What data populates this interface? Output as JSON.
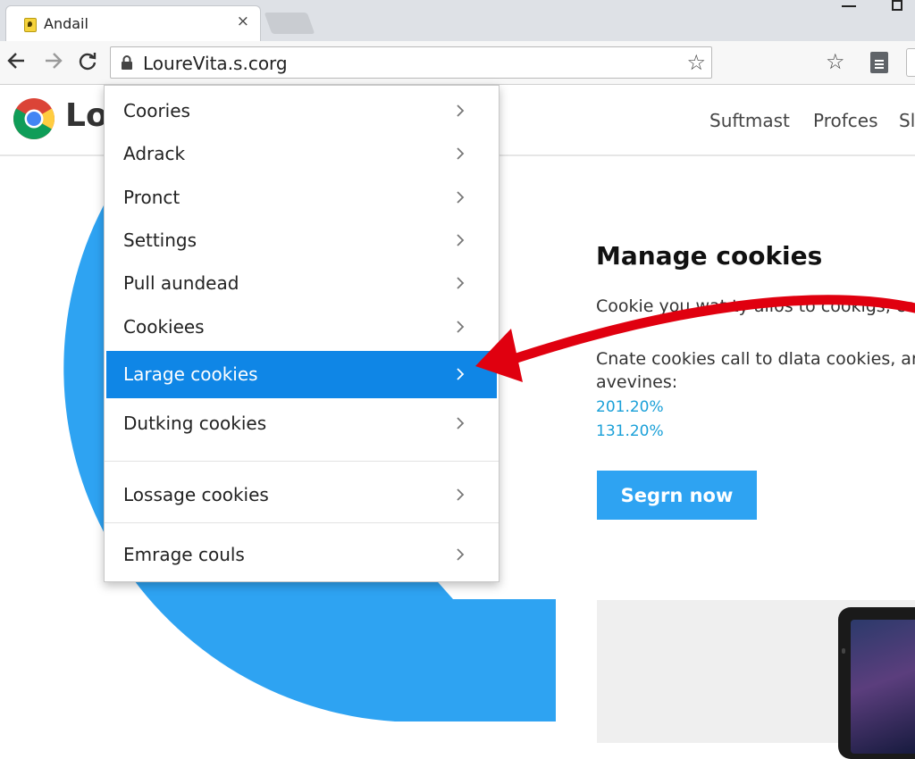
{
  "browser": {
    "tab_title": "Andail",
    "tab_close": "×",
    "url": "LoureVita.s.corg"
  },
  "site": {
    "name": "Lou",
    "nav": [
      "Suftmast",
      "Profces",
      "Sl"
    ]
  },
  "menu": {
    "items": [
      {
        "label": "Coories"
      },
      {
        "label": "Adrack"
      },
      {
        "label": "Pronct"
      },
      {
        "label": "Settings"
      },
      {
        "label": "Pull aundead"
      },
      {
        "label": "Cookiees"
      },
      {
        "label": "Larage cookies",
        "selected": true
      },
      {
        "label": "Dutking cookies"
      },
      {
        "label": "Lossage cookies"
      },
      {
        "label": "Emrage couls"
      }
    ]
  },
  "content": {
    "title": "Manage cookies",
    "line1": "Cookie you wat ty allos to cookigs, cool",
    "line2": "Cnate cookies call to dlata cookies, and",
    "line3": "avevines:",
    "stats": [
      "201.20%",
      "131.20%"
    ],
    "cta": "Segrn now"
  },
  "colors": {
    "accent_blue": "#2ea3f2",
    "menu_selected": "#0f86e6",
    "arrow_red": "#e0000f",
    "stat_text": "#1aa0d8"
  },
  "icons": [
    "back-icon",
    "forward-icon",
    "reload-icon",
    "lock-icon",
    "bookmark-star-icon",
    "document-icon",
    "chrome-logo-icon",
    "chevron-right-icon"
  ]
}
